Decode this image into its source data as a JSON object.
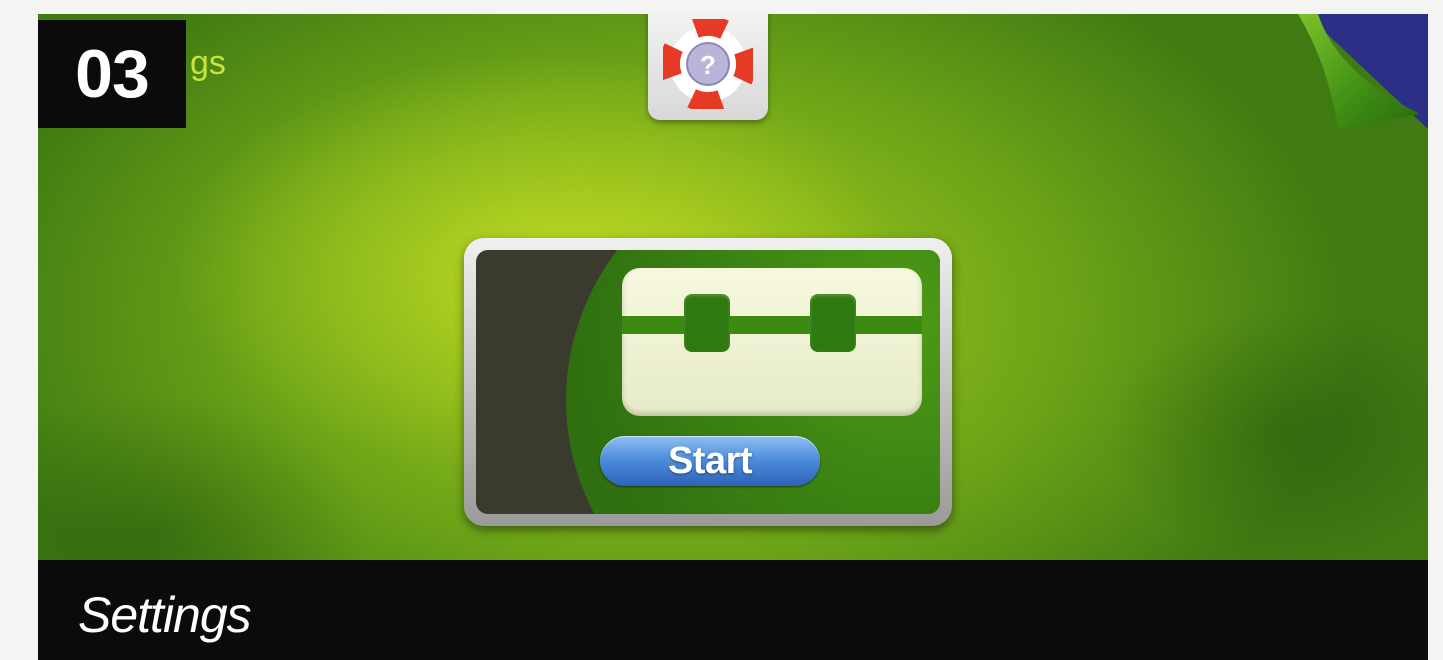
{
  "step": {
    "number": "03"
  },
  "header": {
    "title_fragment": "gs"
  },
  "help": {
    "icon": "help-lifebuoy-icon"
  },
  "panel": {
    "start_label": "Start",
    "slider_icon": "slider-track-icon"
  },
  "caption": {
    "text": "Settings"
  },
  "colors": {
    "screen_green": "#8dbd1c",
    "corner_blue": "#2b2f86",
    "start_blue": "#4f8fdc",
    "caption_black": "#0c0b0c"
  }
}
